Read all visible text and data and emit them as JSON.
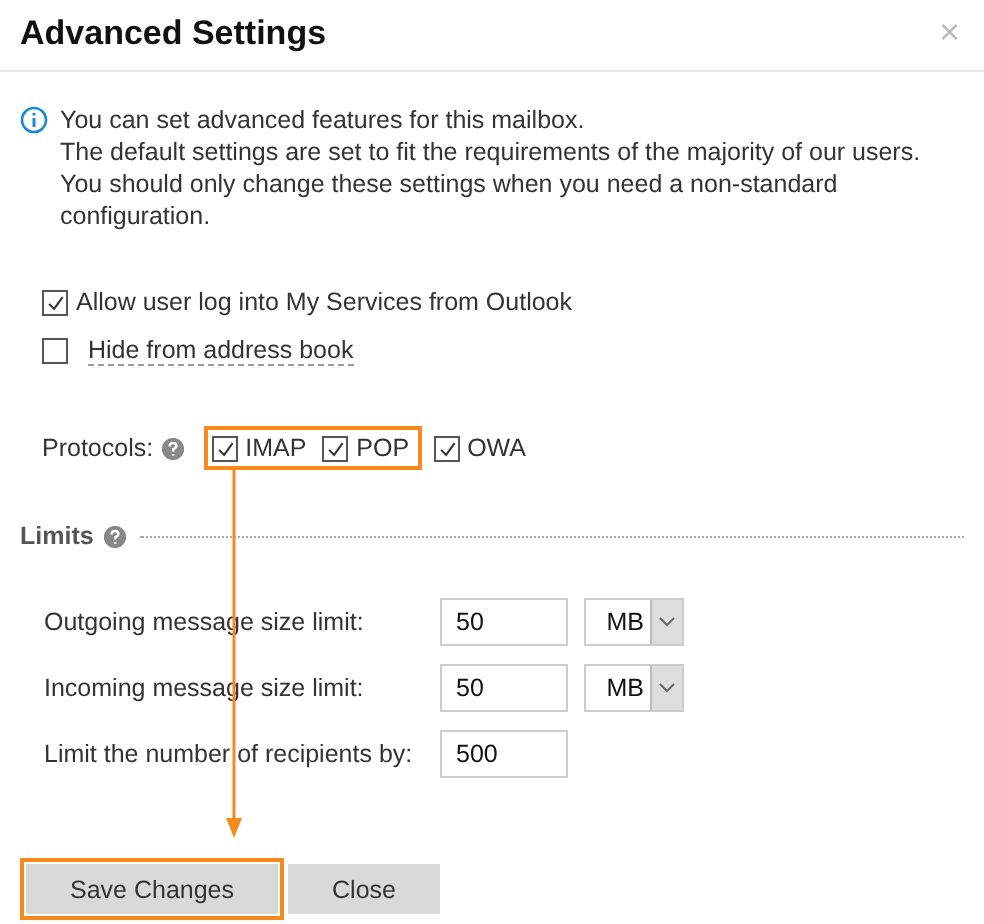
{
  "dialog": {
    "title": "Advanced Settings",
    "close": "×"
  },
  "info": [
    "You can set advanced features for this mailbox.",
    "The default settings are set to fit the requirements of the majority of our users.",
    "You should only change these settings when you need a non-standard configuration."
  ],
  "options": [
    {
      "label": "Allow user log into My Services from Outlook",
      "checked": true
    },
    {
      "label": "Hide from address book",
      "checked": false
    }
  ],
  "protocols": {
    "label": "Protocols:",
    "items": [
      {
        "label": "IMAP",
        "checked": true,
        "highlighted": true
      },
      {
        "label": "POP",
        "checked": true,
        "highlighted": true
      },
      {
        "label": "OWA",
        "checked": true,
        "highlighted": false
      }
    ]
  },
  "limits": {
    "title": "Limits",
    "rows": [
      {
        "label": "Outgoing message size limit:",
        "value": "50",
        "unit": "MB"
      },
      {
        "label": "Incoming message size limit:",
        "value": "50",
        "unit": "MB"
      },
      {
        "label": "Limit the number of recipients by:",
        "value": "500"
      }
    ]
  },
  "buttons": [
    {
      "label": "Save Changes",
      "highlighted": true
    },
    {
      "label": "Close",
      "highlighted": false
    }
  ]
}
